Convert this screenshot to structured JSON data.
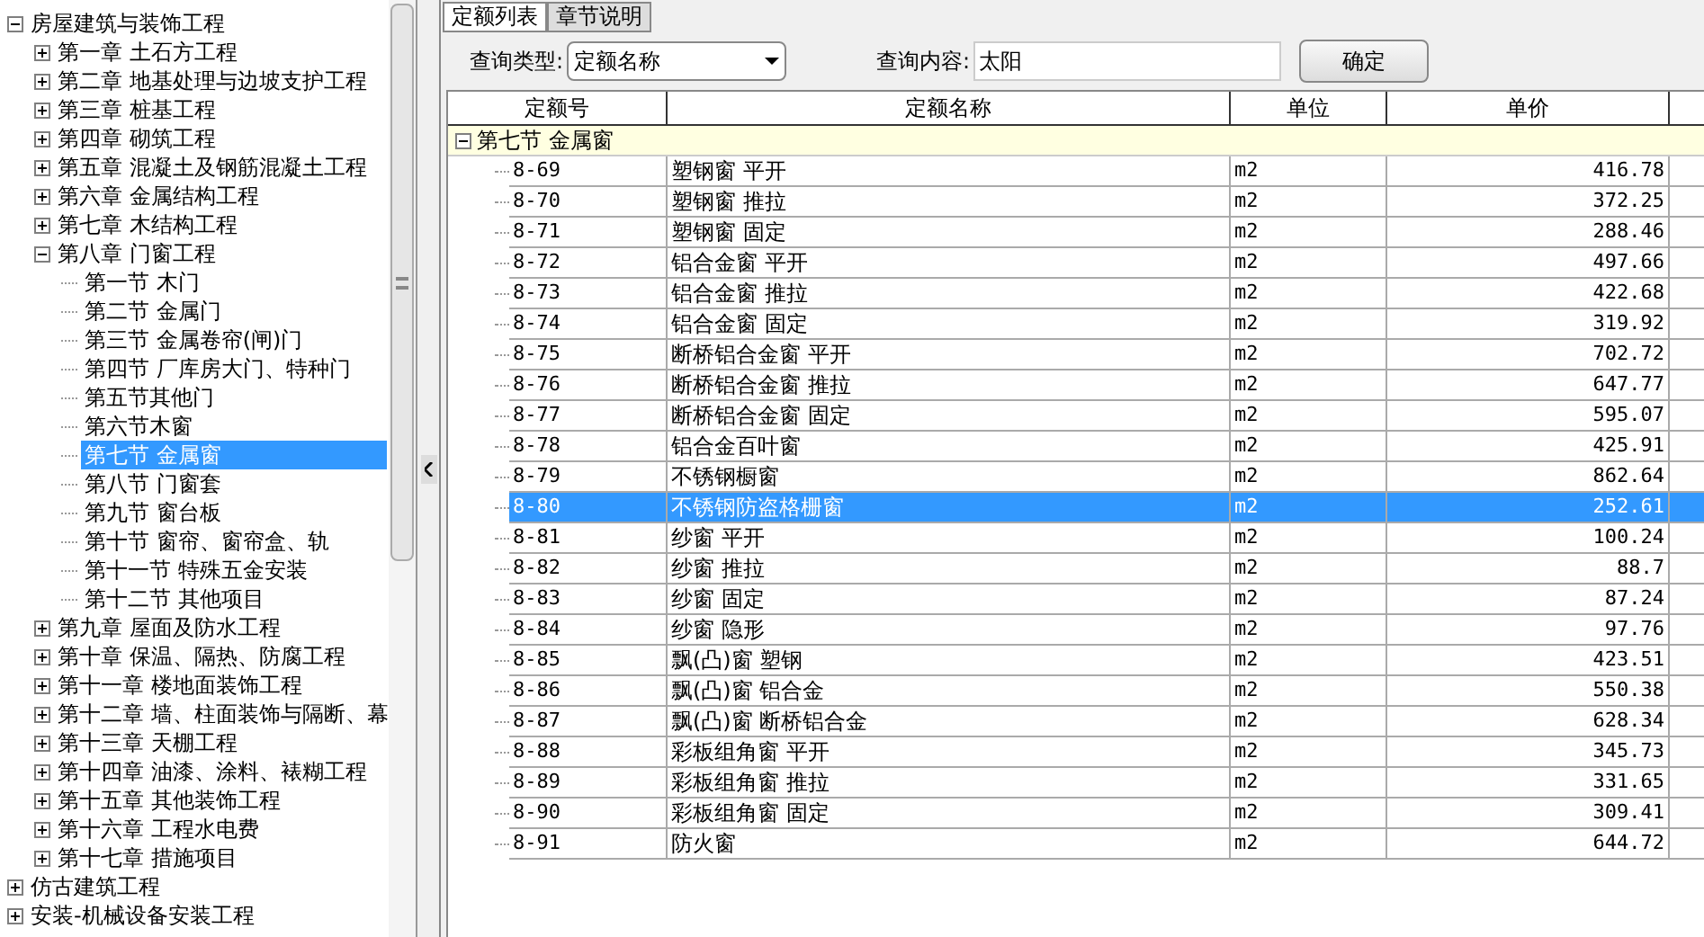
{
  "tree": [
    {
      "label": "房屋建筑与装饰工程",
      "expanded": true,
      "selected": false,
      "children": [
        {
          "label": "第一章  土石方工程",
          "expanded": false,
          "selected": false
        },
        {
          "label": "第二章  地基处理与边坡支护工程",
          "expanded": false,
          "selected": false
        },
        {
          "label": "第三章  桩基工程",
          "expanded": false,
          "selected": false
        },
        {
          "label": "第四章  砌筑工程",
          "expanded": false,
          "selected": false
        },
        {
          "label": "第五章  混凝土及钢筋混凝土工程",
          "expanded": false,
          "selected": false
        },
        {
          "label": "第六章  金属结构工程",
          "expanded": false,
          "selected": false
        },
        {
          "label": "第七章  木结构工程",
          "expanded": false,
          "selected": false
        },
        {
          "label": "第八章  门窗工程",
          "expanded": true,
          "selected": false,
          "children": [
            {
              "label": "第一节  木门",
              "selected": false
            },
            {
              "label": "第二节  金属门",
              "selected": false
            },
            {
              "label": "第三节  金属卷帘(闸)门",
              "selected": false
            },
            {
              "label": "第四节  厂库房大门、特种门",
              "selected": false
            },
            {
              "label": "第五节其他门",
              "selected": false
            },
            {
              "label": "第六节木窗",
              "selected": false
            },
            {
              "label": "第七节  金属窗",
              "selected": true
            },
            {
              "label": "第八节  门窗套",
              "selected": false
            },
            {
              "label": "第九节  窗台板",
              "selected": false
            },
            {
              "label": "第十节  窗帘、窗帘盒、轨",
              "selected": false
            },
            {
              "label": "第十一节  特殊五金安装",
              "selected": false
            },
            {
              "label": "第十二节  其他项目",
              "selected": false
            }
          ]
        },
        {
          "label": "第九章  屋面及防水工程",
          "expanded": false,
          "selected": false
        },
        {
          "label": "第十章  保温、隔热、防腐工程",
          "expanded": false,
          "selected": false
        },
        {
          "label": "第十一章  楼地面装饰工程",
          "expanded": false,
          "selected": false
        },
        {
          "label": "第十二章  墙、柱面装饰与隔断、幕",
          "expanded": false,
          "selected": false
        },
        {
          "label": "第十三章  天棚工程",
          "expanded": false,
          "selected": false
        },
        {
          "label": "第十四章  油漆、涂料、裱糊工程",
          "expanded": false,
          "selected": false
        },
        {
          "label": "第十五章  其他装饰工程",
          "expanded": false,
          "selected": false
        },
        {
          "label": "第十六章  工程水电费",
          "expanded": false,
          "selected": false
        },
        {
          "label": "第十七章  措施项目",
          "expanded": false,
          "selected": false
        }
      ]
    },
    {
      "label": "仿古建筑工程",
      "expanded": false,
      "selected": false
    },
    {
      "label": "安装-机械设备安装工程",
      "expanded": false,
      "selected": false
    }
  ],
  "tabs": [
    {
      "label": "定额列表",
      "selected": true
    },
    {
      "label": "章节说明",
      "selected": false
    }
  ],
  "query": {
    "type_label": "查询类型:",
    "type_value": "定额名称",
    "content_label": "查询内容:",
    "content_value": "太阳",
    "button": "确定"
  },
  "table": {
    "columns": [
      "定额号",
      "定额名称",
      "单位",
      "单价"
    ],
    "group": {
      "label": "第七节  金属窗",
      "expanded": true
    },
    "rows": [
      {
        "code": "8-69",
        "name": "塑钢窗  平开",
        "unit": "m2",
        "price": "416.78",
        "selected": false
      },
      {
        "code": "8-70",
        "name": "塑钢窗  推拉",
        "unit": "m2",
        "price": "372.25",
        "selected": false
      },
      {
        "code": "8-71",
        "name": "塑钢窗  固定",
        "unit": "m2",
        "price": "288.46",
        "selected": false
      },
      {
        "code": "8-72",
        "name": "铝合金窗  平开",
        "unit": "m2",
        "price": "497.66",
        "selected": false
      },
      {
        "code": "8-73",
        "name": "铝合金窗  推拉",
        "unit": "m2",
        "price": "422.68",
        "selected": false
      },
      {
        "code": "8-74",
        "name": "铝合金窗  固定",
        "unit": "m2",
        "price": "319.92",
        "selected": false
      },
      {
        "code": "8-75",
        "name": "断桥铝合金窗  平开",
        "unit": "m2",
        "price": "702.72",
        "selected": false
      },
      {
        "code": "8-76",
        "name": "断桥铝合金窗  推拉",
        "unit": "m2",
        "price": "647.77",
        "selected": false
      },
      {
        "code": "8-77",
        "name": "断桥铝合金窗  固定",
        "unit": "m2",
        "price": "595.07",
        "selected": false
      },
      {
        "code": "8-78",
        "name": "铝合金百叶窗",
        "unit": "m2",
        "price": "425.91",
        "selected": false
      },
      {
        "code": "8-79",
        "name": "不锈钢橱窗",
        "unit": "m2",
        "price": "862.64",
        "selected": false
      },
      {
        "code": "8-80",
        "name": "不锈钢防盗格栅窗",
        "unit": "m2",
        "price": "252.61",
        "selected": true
      },
      {
        "code": "8-81",
        "name": "纱窗  平开",
        "unit": "m2",
        "price": "100.24",
        "selected": false
      },
      {
        "code": "8-82",
        "name": "纱窗  推拉",
        "unit": "m2",
        "price": "88.7",
        "selected": false
      },
      {
        "code": "8-83",
        "name": "纱窗  固定",
        "unit": "m2",
        "price": "87.24",
        "selected": false
      },
      {
        "code": "8-84",
        "name": "纱窗  隐形",
        "unit": "m2",
        "price": "97.76",
        "selected": false
      },
      {
        "code": "8-85",
        "name": "飘(凸)窗  塑钢",
        "unit": "m2",
        "price": "423.51",
        "selected": false
      },
      {
        "code": "8-86",
        "name": "飘(凸)窗  铝合金",
        "unit": "m2",
        "price": "550.38",
        "selected": false
      },
      {
        "code": "8-87",
        "name": "飘(凸)窗  断桥铝合金",
        "unit": "m2",
        "price": "628.34",
        "selected": false
      },
      {
        "code": "8-88",
        "name": "彩板组角窗  平开",
        "unit": "m2",
        "price": "345.73",
        "selected": false
      },
      {
        "code": "8-89",
        "name": "彩板组角窗  推拉",
        "unit": "m2",
        "price": "331.65",
        "selected": false
      },
      {
        "code": "8-90",
        "name": "彩板组角窗  固定",
        "unit": "m2",
        "price": "309.41",
        "selected": false
      },
      {
        "code": "8-91",
        "name": "防火窗",
        "unit": "m2",
        "price": "644.72",
        "selected": false
      }
    ]
  }
}
